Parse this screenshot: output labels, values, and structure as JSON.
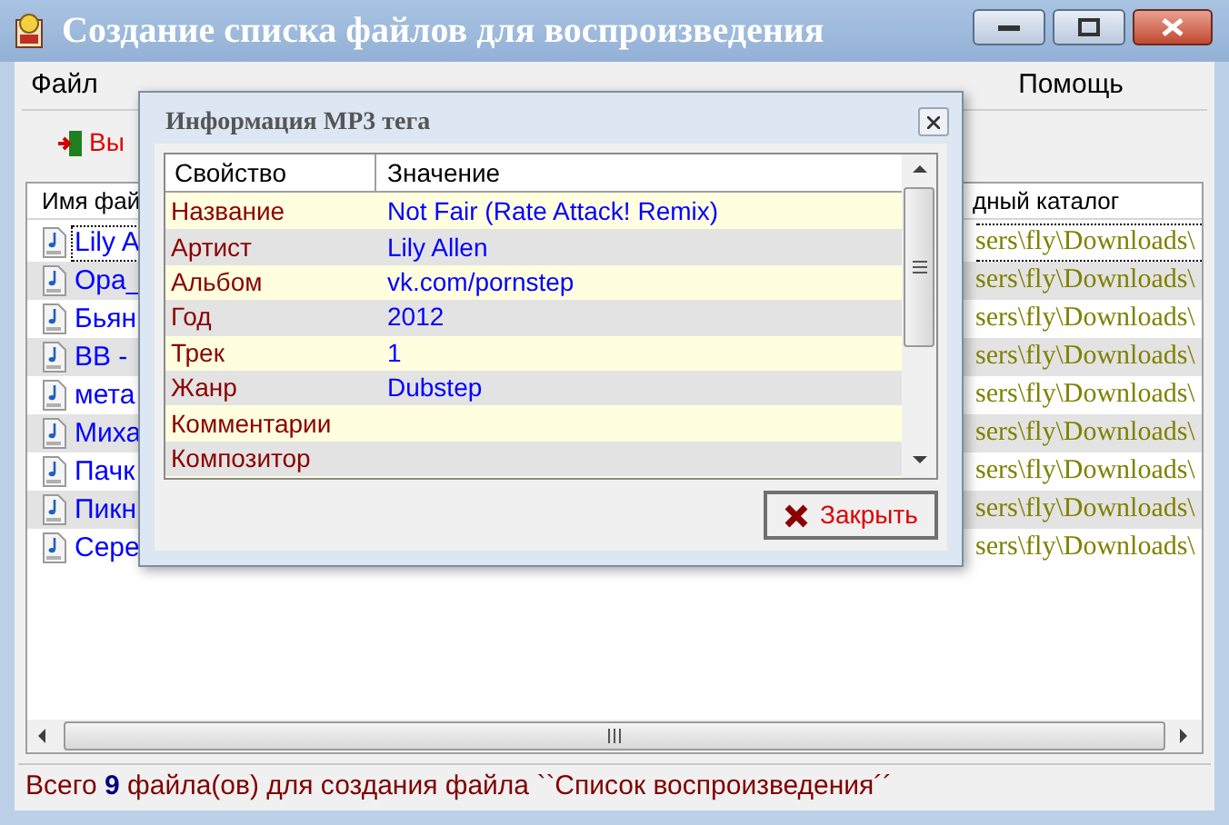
{
  "window": {
    "title": "Создание списка файлов для воспроизведения"
  },
  "menu": [
    {
      "label": "Файл"
    },
    {
      "label": "Помощь"
    }
  ],
  "toolbar": [
    {
      "label": "Вы"
    }
  ],
  "list": {
    "columns": [
      "Имя фай",
      "дный каталог"
    ],
    "rows": [
      {
        "name": "Lily A",
        "folder": "sers\\fly\\Downloads\\",
        "selected": true
      },
      {
        "name": "Ора_",
        "folder": "sers\\fly\\Downloads\\",
        "selected": false
      },
      {
        "name": "Бьян",
        "folder": "sers\\fly\\Downloads\\",
        "selected": false
      },
      {
        "name": "BB -",
        "folder": "sers\\fly\\Downloads\\",
        "selected": false
      },
      {
        "name": "мета",
        "folder": "sers\\fly\\Downloads\\",
        "selected": false
      },
      {
        "name": "Миха",
        "folder": "sers\\fly\\Downloads\\",
        "selected": false
      },
      {
        "name": "Пачк",
        "folder": "sers\\fly\\Downloads\\",
        "selected": false
      },
      {
        "name": "Пикн",
        "folder": "sers\\fly\\Downloads\\",
        "selected": false
      },
      {
        "name": "Сере",
        "folder": "sers\\fly\\Downloads\\",
        "selected": false
      }
    ]
  },
  "status": "Всего **9** файла(ов) для создания файла ``Список воспроизведения´´",
  "dialog": {
    "title": "Информация MP3 тега",
    "columns": [
      "Свойство",
      "Значение"
    ],
    "rows": [
      {
        "property": "Название",
        "value": "Not Fair (Rate Attack! Remix)"
      },
      {
        "property": "Артист",
        "value": "Lily Allen"
      },
      {
        "property": "Альбом",
        "value": "vk.com/pornstep"
      },
      {
        "property": "Год",
        "value": "2012"
      },
      {
        "property": "Трек",
        "value": "1"
      },
      {
        "property": "Жанр",
        "value": "Dubstep"
      },
      {
        "property": "Комментарии"
      },
      {
        "property": "Композитор"
      }
    ],
    "button": "Закрыть"
  }
}
